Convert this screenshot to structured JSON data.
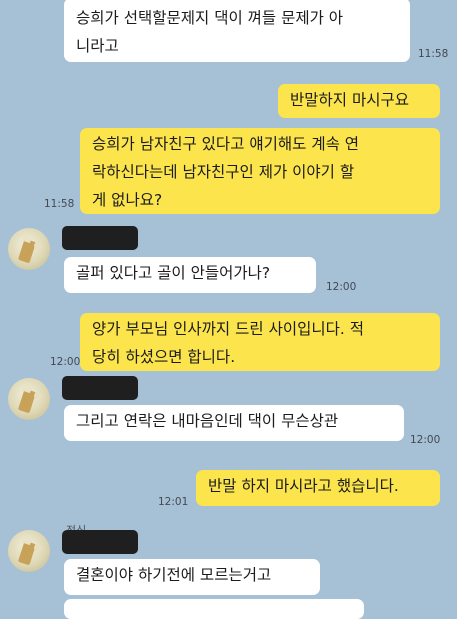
{
  "messages": [
    {
      "text": "승희가 선택할문제지 댁이 껴들 문제가 아\n니라고",
      "time": "11:58"
    },
    {
      "text": "반말하지 마시구요",
      "time": ""
    },
    {
      "text": "승희가 남자친구 있다고 얘기해도 계속 연\n락하신다는데 남자친구인 제가 이야기 할\n게 없나요?",
      "time": "11:58"
    },
    {
      "text": "골퍼 있다고 골이 안들어가나?",
      "time": "12:00"
    },
    {
      "text": "양가 부모님 인사까지 드린 사이입니다. 적\n당히 하셨으면 합니다.",
      "time": "12:00"
    },
    {
      "text": "그리고 연락은 내마음인데 댁이 무슨상관",
      "time": "12:00"
    },
    {
      "text": "반말 하지 마시라고 했습니다.",
      "time": "12:01"
    },
    {
      "text": "결혼이야 하기전에 모르는거고",
      "time": ""
    }
  ],
  "sender_partial_name": "정심",
  "colors": {
    "background": "#a6c0d6",
    "incoming": "#ffffff",
    "outgoing": "#fbe44c"
  }
}
